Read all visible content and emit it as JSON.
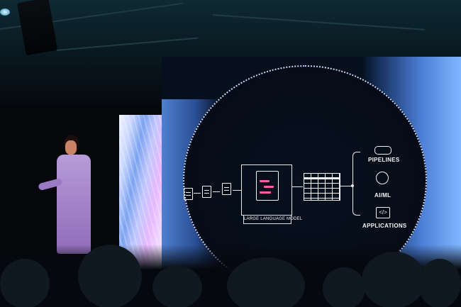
{
  "scene": {
    "description_free": true
  },
  "slide": {
    "llm_label": "LARGE LANGUAGE MODEL",
    "outputs": [
      {
        "label": "PIPELINES",
        "icon": "pipe-icon"
      },
      {
        "label": "AI/ML",
        "icon": "brain-icon"
      },
      {
        "label": "APPLICATIONS",
        "icon": "code-icon"
      }
    ],
    "colors": {
      "accent": "#ff5fa0",
      "screen_edge": "#7fb6ff"
    }
  }
}
